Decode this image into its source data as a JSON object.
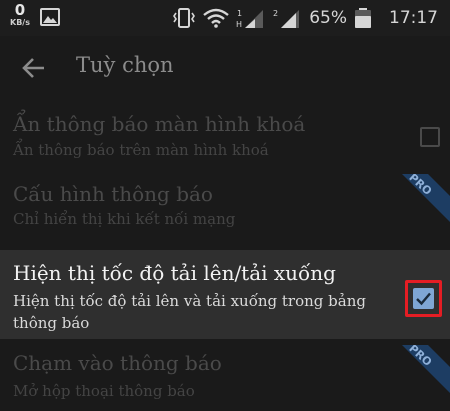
{
  "status_bar": {
    "net_speed": "0",
    "net_speed_unit": "KB/s",
    "sim1": "1",
    "sim2": "2",
    "battery_percent": "65%",
    "time": "17:17"
  },
  "toolbar": {
    "title": "Tuỳ chọn"
  },
  "preferences": [
    {
      "title": "Ẩn thông báo màn hình khoá",
      "summary": "Ẩn thông báo trên màn hình khoá",
      "checked": false,
      "enabled": false
    },
    {
      "title": "Cấu hình thông báo",
      "summary": "Chỉ hiển thị khi kết nối mạng",
      "badge": "PRO",
      "enabled": false
    },
    {
      "title": "Hiện thị tốc độ tải lên/tải xuống",
      "summary": "Hiện thị tốc độ tải lên và tải xuống trong bảng thông báo",
      "checked": true,
      "enabled": true
    },
    {
      "title": "Chạm vào thông báo",
      "summary": "Mở hộp thoại thông báo",
      "badge": "PRO",
      "enabled": false
    }
  ],
  "colors": {
    "accent_checkbox": "#7fa6d4",
    "highlight_border": "#e51d24",
    "pro_ribbon": "#1d3d63"
  }
}
